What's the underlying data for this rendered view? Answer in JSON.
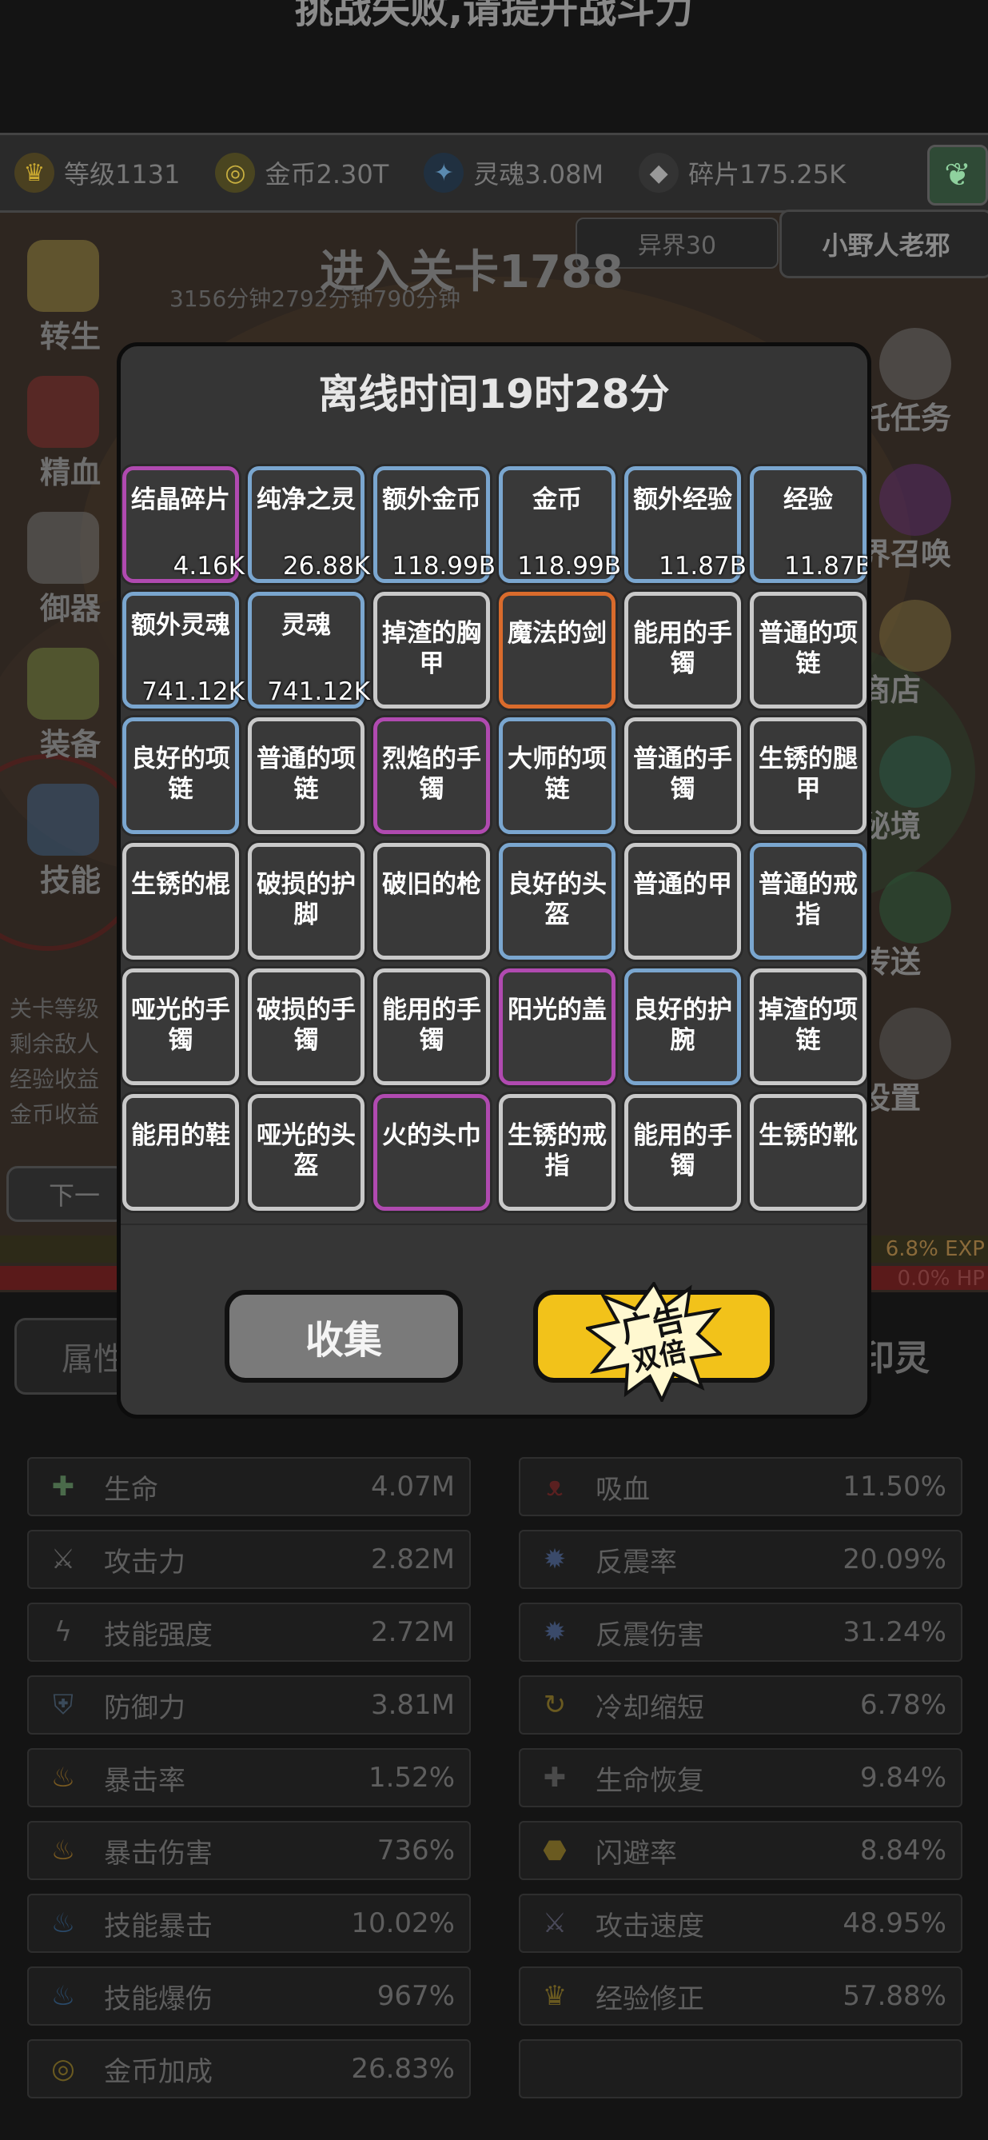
{
  "top_banner": "挑战失败,请提升战斗力",
  "resources": [
    {
      "icon": "crown-icon",
      "label": "等级1131",
      "color": "#b79a3a"
    },
    {
      "icon": "coin-icon",
      "label": "金币2.30T",
      "color": "#b4a24a"
    },
    {
      "icon": "soul-icon",
      "label": "灵魂3.08M",
      "color": "#4a7aa0"
    },
    {
      "icon": "shard-icon",
      "label": "碎片175.25K",
      "color": "#8a8a8a"
    }
  ],
  "realm": "异界30",
  "npc": "小野人老邪",
  "stage": {
    "title": "进入关卡1788",
    "subtitle": "3156分钟2792分钟790分钟"
  },
  "left_menu": [
    {
      "icon": "rebirth-icon",
      "label": "转生"
    },
    {
      "icon": "essence-icon",
      "label": "精血"
    },
    {
      "icon": "weapon-icon",
      "label": "御器"
    },
    {
      "icon": "equipment-icon",
      "label": "装备"
    },
    {
      "icon": "skill-icon",
      "label": "技能"
    }
  ],
  "right_menu": [
    {
      "icon": "task-icon",
      "label": "托任务"
    },
    {
      "icon": "summon-icon",
      "label": "界召唤"
    },
    {
      "icon": "shop-icon",
      "label": "商店"
    },
    {
      "icon": "secret-realm-icon",
      "label": "秘境"
    },
    {
      "icon": "teleport-icon",
      "label": "传送"
    },
    {
      "icon": "settings-icon",
      "label": "设置"
    }
  ],
  "left_info": [
    "关卡等级",
    "剩余敌人",
    "经验收益",
    "金币收益"
  ],
  "next_button": "下一",
  "exp_text": "6.8% EXP",
  "hp_text": "0.0% HP",
  "tab_left": "属性",
  "tab_right": "印灵",
  "modal": {
    "title": "离线时间19时28分",
    "collect_label": "收集",
    "ad_label_1": "广告",
    "ad_label_2": "双倍"
  },
  "items": [
    {
      "name": "结晶碎片",
      "count": "4.16K",
      "quality": "purple"
    },
    {
      "name": "纯净之灵",
      "count": "26.88K",
      "quality": "blue"
    },
    {
      "name": "额外金币",
      "count": "118.99B",
      "quality": "blue"
    },
    {
      "name": "金币",
      "count": "118.99B",
      "quality": "blue"
    },
    {
      "name": "额外经验",
      "count": "11.87B",
      "quality": "blue"
    },
    {
      "name": "经验",
      "count": "11.87B",
      "quality": "blue"
    },
    {
      "name": "额外灵魂",
      "count": "741.12K",
      "quality": "blue"
    },
    {
      "name": "灵魂",
      "count": "741.12K",
      "quality": "blue"
    },
    {
      "name": "掉渣的胸甲",
      "count": "",
      "quality": "white"
    },
    {
      "name": "魔法的剑",
      "count": "",
      "quality": "orange"
    },
    {
      "name": "能用的手镯",
      "count": "",
      "quality": "white"
    },
    {
      "name": "普通的项链",
      "count": "",
      "quality": "white"
    },
    {
      "name": "良好的项链",
      "count": "",
      "quality": "blue"
    },
    {
      "name": "普通的项链",
      "count": "",
      "quality": "white"
    },
    {
      "name": "烈焰的手镯",
      "count": "",
      "quality": "purple"
    },
    {
      "name": "大师的项链",
      "count": "",
      "quality": "blue"
    },
    {
      "name": "普通的手镯",
      "count": "",
      "quality": "white"
    },
    {
      "name": "生锈的腿甲",
      "count": "",
      "quality": "white"
    },
    {
      "name": "生锈的棍",
      "count": "",
      "quality": "white"
    },
    {
      "name": "破损的护脚",
      "count": "",
      "quality": "white"
    },
    {
      "name": "破旧的枪",
      "count": "",
      "quality": "white"
    },
    {
      "name": "良好的头盔",
      "count": "",
      "quality": "blue"
    },
    {
      "name": "普通的甲",
      "count": "",
      "quality": "white"
    },
    {
      "name": "普通的戒指",
      "count": "",
      "quality": "blue"
    },
    {
      "name": "哑光的手镯",
      "count": "",
      "quality": "white"
    },
    {
      "name": "破损的手镯",
      "count": "",
      "quality": "white"
    },
    {
      "name": "能用的手镯",
      "count": "",
      "quality": "white"
    },
    {
      "name": "阳光的盖",
      "count": "",
      "quality": "purple"
    },
    {
      "name": "良好的护腕",
      "count": "",
      "quality": "blue"
    },
    {
      "name": "掉渣的项链",
      "count": "",
      "quality": "white"
    },
    {
      "name": "能用的鞋",
      "count": "",
      "quality": "white"
    },
    {
      "name": "哑光的头盔",
      "count": "",
      "quality": "white"
    },
    {
      "name": "火的头巾",
      "count": "",
      "quality": "purple"
    },
    {
      "name": "生锈的戒指",
      "count": "",
      "quality": "white"
    },
    {
      "name": "能用的手镯",
      "count": "",
      "quality": "white"
    },
    {
      "name": "生锈的靴",
      "count": "",
      "quality": "white"
    }
  ],
  "stats_left": [
    {
      "icon": "life-icon",
      "name": "生命",
      "value": "4.07M",
      "color": "#4a6a4a"
    },
    {
      "icon": "sword-icon",
      "name": "攻击力",
      "value": "2.82M",
      "color": "#5a5a5a"
    },
    {
      "icon": "lightning-icon",
      "name": "技能强度",
      "value": "2.72M",
      "color": "#5a5a5a"
    },
    {
      "icon": "shield-icon",
      "name": "防御力",
      "value": "3.81M",
      "color": "#3a4a5a"
    },
    {
      "icon": "flame-icon",
      "name": "暴击率",
      "value": "1.52%",
      "color": "#7a5a20"
    },
    {
      "icon": "flame-icon",
      "name": "暴击伤害",
      "value": "736%",
      "color": "#7a5a20"
    },
    {
      "icon": "blue-flame-icon",
      "name": "技能暴击",
      "value": "10.02%",
      "color": "#2a4a6a"
    },
    {
      "icon": "blue-flame-icon",
      "name": "技能爆伤",
      "value": "967%",
      "color": "#2a4a6a"
    },
    {
      "icon": "coin-icon",
      "name": "金币加成",
      "value": "26.83%",
      "color": "#6a5a20"
    }
  ],
  "stats_right": [
    {
      "icon": "bat-icon",
      "name": "吸血",
      "value": "11.50%",
      "color": "#5a2020"
    },
    {
      "icon": "spike-icon",
      "name": "反震率",
      "value": "20.09%",
      "color": "#3a4a6a"
    },
    {
      "icon": "spike-icon",
      "name": "反震伤害",
      "value": "31.24%",
      "color": "#3a4a6a"
    },
    {
      "icon": "cooldown-icon",
      "name": "冷却缩短",
      "value": "6.78%",
      "color": "#6a5a20"
    },
    {
      "icon": "heal-icon",
      "name": "生命恢复",
      "value": "9.84%",
      "color": "#4a4a4a"
    },
    {
      "icon": "boot-icon",
      "name": "闪避率",
      "value": "8.84%",
      "color": "#6a5a20"
    },
    {
      "icon": "swords-icon",
      "name": "攻击速度",
      "value": "48.95%",
      "color": "#4a4a5a"
    },
    {
      "icon": "crown-icon",
      "name": "经验修正",
      "value": "57.88%",
      "color": "#6a5a20"
    },
    {
      "icon": "",
      "name": "",
      "value": "",
      "color": "#1d1d1d"
    }
  ]
}
